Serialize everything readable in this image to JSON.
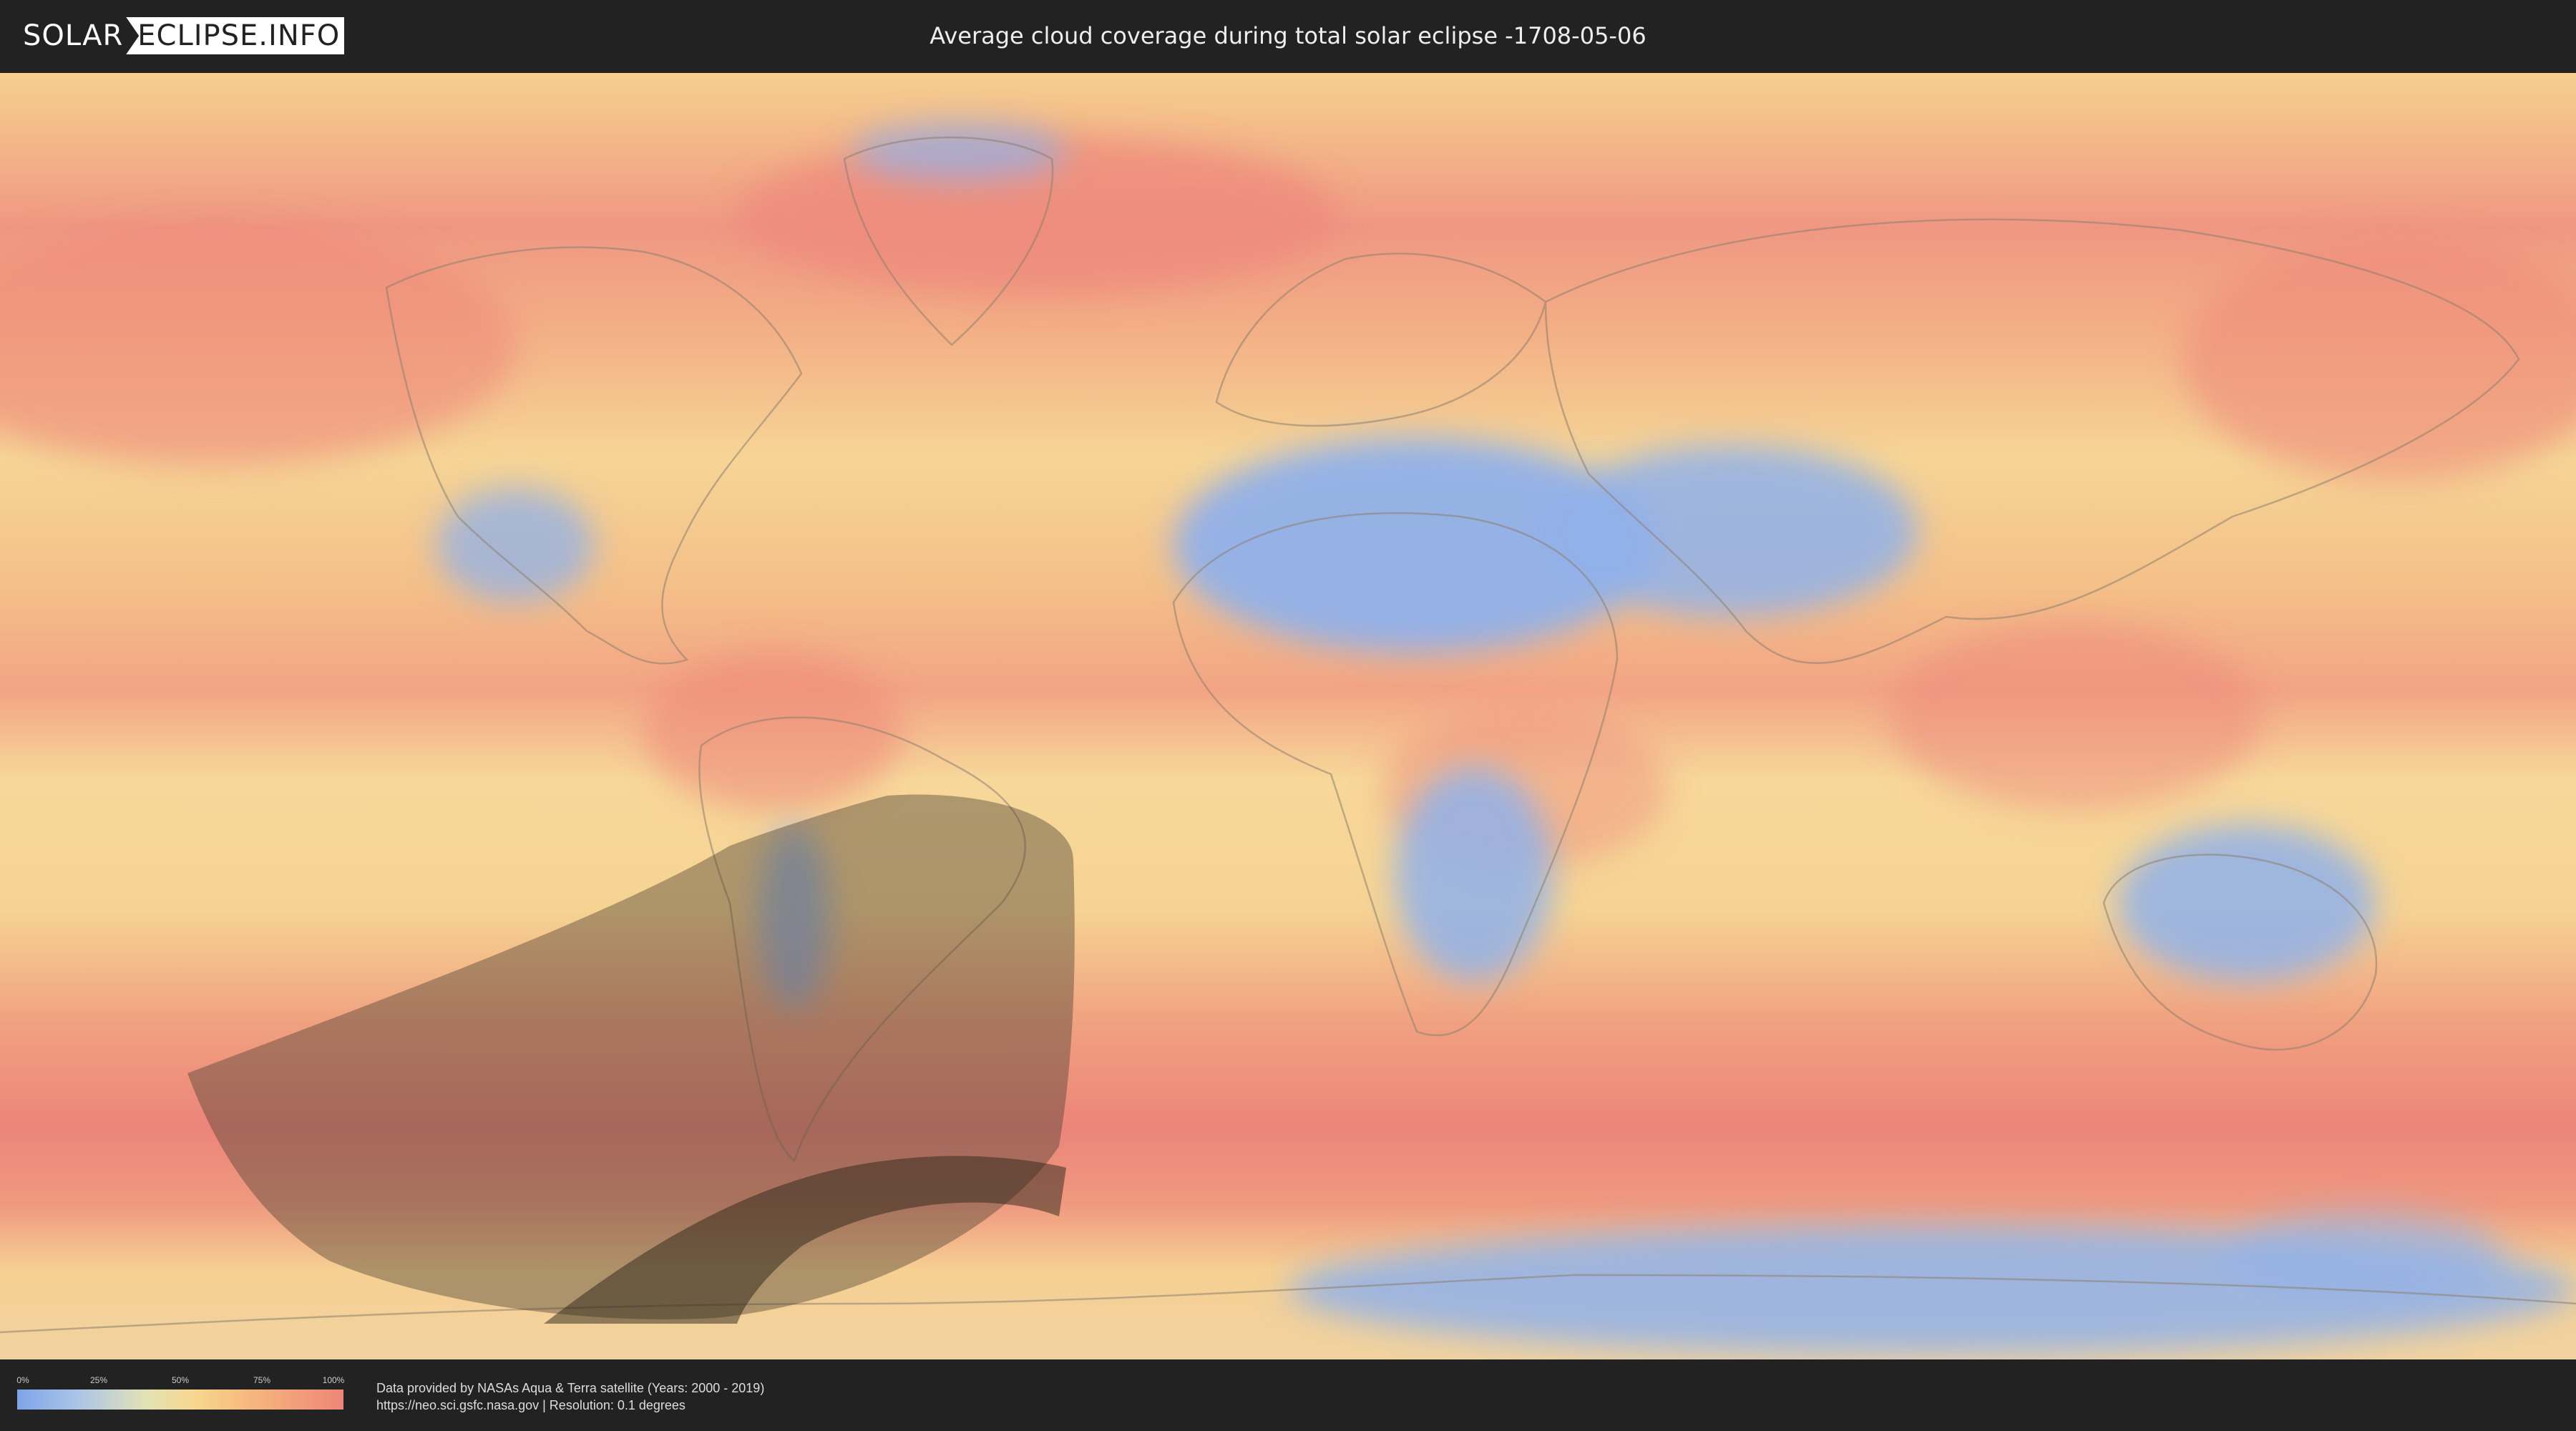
{
  "header": {
    "logo_left": "SOLAR",
    "logo_right": "ECLIPSE.INFO",
    "title": "Average cloud coverage during total solar eclipse -1708-05-06"
  },
  "legend": {
    "ticks": [
      "0%",
      "25%",
      "50%",
      "75%",
      "100%"
    ],
    "colors": [
      "#7fa3e8",
      "#e4e2b4",
      "#f7d68c",
      "#f5b17c",
      "#ee8577"
    ]
  },
  "footer": {
    "credit_line1": "Data provided by NASAs Aqua & Terra satellite (Years: 2000 - 2019)",
    "credit_line2": "https://neo.sci.gsfc.nasa.gov | Resolution: 0.1 degrees"
  },
  "map": {
    "projection": "equirectangular",
    "colors": {
      "clear": "#8fb0ea",
      "moderate": "#f6d89a",
      "cloudy": "#ee8a7c",
      "shadow_region": "#5a5040",
      "totality_path": "#2c2418"
    }
  }
}
